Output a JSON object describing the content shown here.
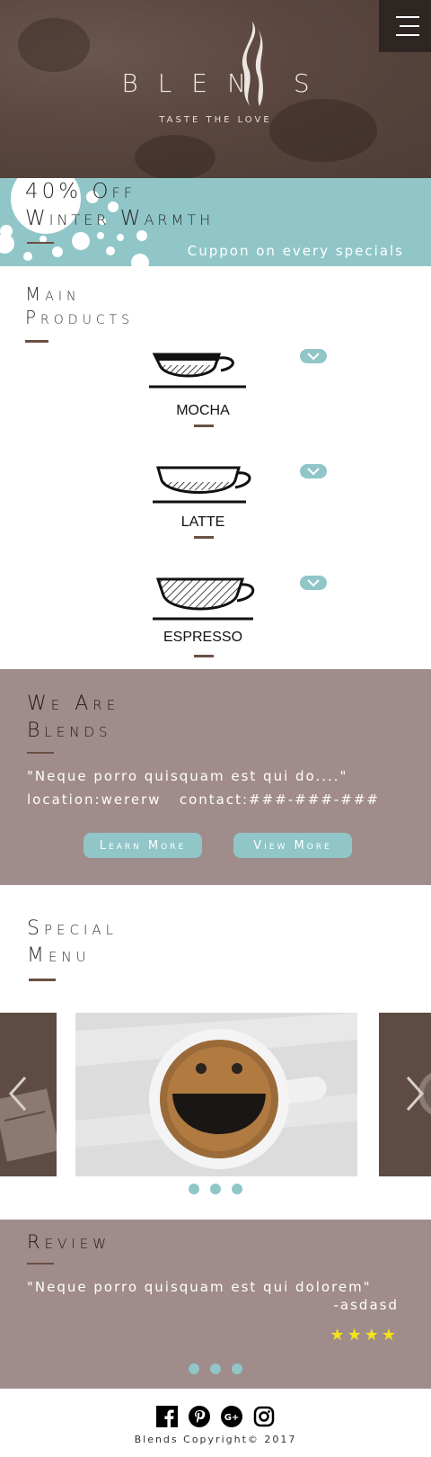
{
  "hero": {
    "logo_text": "BLEN S",
    "tagline": "TASTE THE LOVE",
    "colors": {
      "background": "#5a463f",
      "menu_button": "#2e2623"
    }
  },
  "promo": {
    "line1": "40% Off",
    "line2": "Winter Warmth",
    "subtitle": "Cuppon on every specials",
    "color": "#90c6c8"
  },
  "products": {
    "title_line1": "Main",
    "title_line2": "Products",
    "items": [
      {
        "name": "MOCHA",
        "icon": "mocha-cup-icon"
      },
      {
        "name": "LATTE",
        "icon": "latte-cup-icon"
      },
      {
        "name": "ESPRESSO",
        "icon": "espresso-cup-icon"
      }
    ]
  },
  "about": {
    "title_line1": "We Are",
    "title_line2": "Blends",
    "quote": "\"Neque porro quisquam est qui do....\"",
    "location_contact": "location:wererw   contact:###-###-###",
    "learn_more": "Learn More",
    "view_more": "View More"
  },
  "special": {
    "title_line1": "Special",
    "title_line2": "Menu",
    "slides": [
      "coffee-table-photo",
      "smiley-coffee-photo",
      "coffee-cup-photo"
    ]
  },
  "review": {
    "title": "Review",
    "quote": "\"Neque porro quisquam est qui dolorem\"",
    "author": "-asdasd",
    "stars": "★★★★",
    "rating": 4,
    "star_color": "#f5e21a"
  },
  "footer": {
    "copyright": "Blends Copyright© 2017",
    "social": [
      "facebook-icon",
      "pinterest-icon",
      "google-plus-icon",
      "instagram-icon"
    ]
  }
}
